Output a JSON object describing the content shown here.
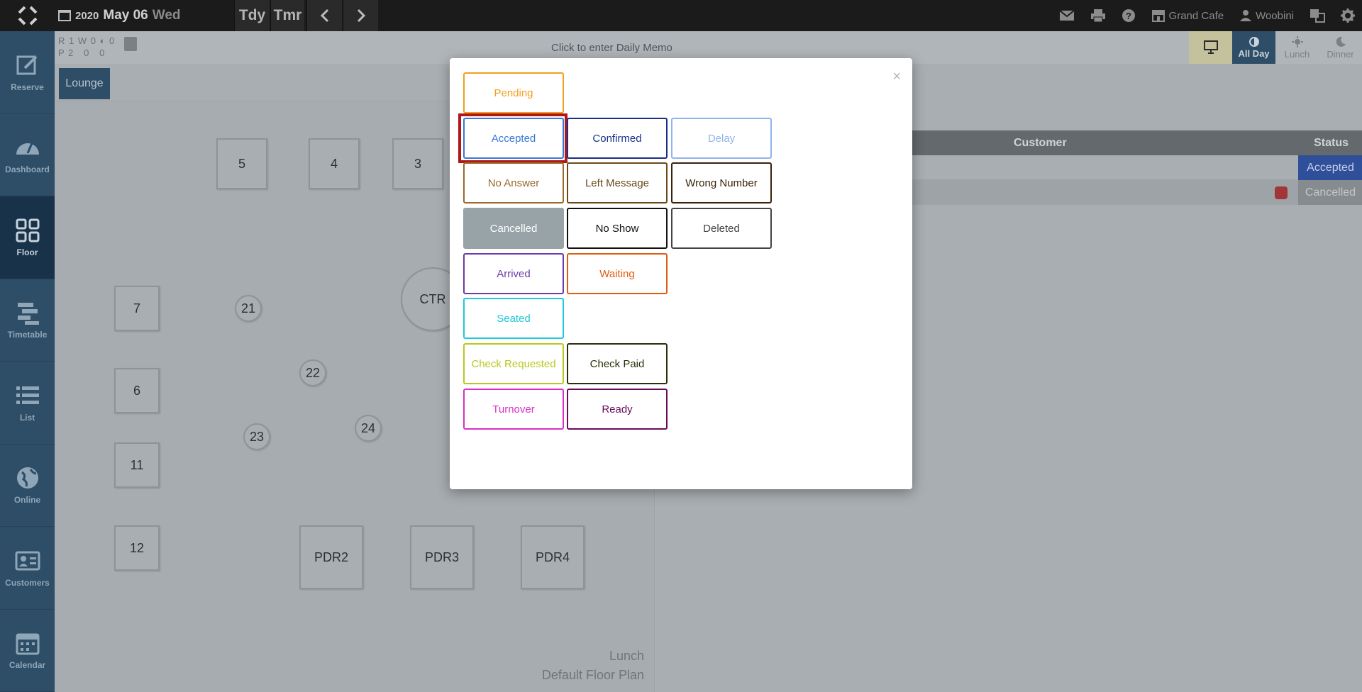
{
  "topbar": {
    "year": "2020",
    "month_day": "May 06",
    "weekday": "Wed",
    "today_label": "Tdy",
    "tomorrow_label": "Tmr",
    "restaurant": "Grand Cafe",
    "user": "Woobini"
  },
  "sidebar": {
    "items": [
      {
        "label": "Reserve",
        "icon": "edit-icon"
      },
      {
        "label": "Dashboard",
        "icon": "gauge-icon"
      },
      {
        "label": "Floor",
        "icon": "grid-icon"
      },
      {
        "label": "Timetable",
        "icon": "timetable-icon"
      },
      {
        "label": "List",
        "icon": "list-icon"
      },
      {
        "label": "Online",
        "icon": "globe-icon"
      },
      {
        "label": "Customers",
        "icon": "id-card-icon"
      },
      {
        "label": "Calendar",
        "icon": "calendar-icon"
      }
    ]
  },
  "subhead": {
    "counts_row1": "R 1 W 0 ◐ 0",
    "counts_row2": "P 2   0   0",
    "daily_memo": "Click to enter Daily Memo",
    "views": [
      {
        "label": ""
      },
      {
        "label": "All Day"
      },
      {
        "label": "Lunch"
      },
      {
        "label": "Dinner"
      }
    ]
  },
  "floor": {
    "tab": "Lounge",
    "tables": [
      "5",
      "4",
      "3",
      "7",
      "21",
      "CTR",
      "22",
      "6",
      "24",
      "23",
      "11",
      "12",
      "PDR2",
      "PDR3",
      "PDR4"
    ],
    "caption_line1": "Lunch",
    "caption_line2": "Default Floor Plan"
  },
  "reservations": {
    "headers": {
      "customer": "Customer",
      "status": "Status"
    },
    "rows": [
      {
        "status": "Accepted"
      },
      {
        "status": "Cancelled"
      }
    ]
  },
  "modal": {
    "close": "×",
    "statuses": [
      {
        "label": "Pending",
        "color": "#f0a020"
      },
      {
        "label": "Accepted",
        "color": "#3a78d8"
      },
      {
        "label": "Confirmed",
        "color": "#1a2f8a"
      },
      {
        "label": "Delay",
        "color": "#8fb4ea"
      },
      {
        "label": "No Answer",
        "color": "#9a6a2a"
      },
      {
        "label": "Left Message",
        "color": "#6a4a1a"
      },
      {
        "label": "Wrong Number",
        "color": "#3a2208"
      },
      {
        "label": "Cancelled",
        "color": "#8a9599"
      },
      {
        "label": "No Show",
        "color": "#111111"
      },
      {
        "label": "Deleted",
        "color": "#444444"
      },
      {
        "label": "Arrived",
        "color": "#6a3aa8"
      },
      {
        "label": "Waiting",
        "color": "#e05a10"
      },
      {
        "label": "Seated",
        "color": "#20c8d8"
      },
      {
        "label": "Check Requested",
        "color": "#b8c820"
      },
      {
        "label": "Check Paid",
        "color": "#2a3008"
      },
      {
        "label": "Turnover",
        "color": "#d830c8"
      },
      {
        "label": "Ready",
        "color": "#6a0a5a"
      }
    ]
  }
}
